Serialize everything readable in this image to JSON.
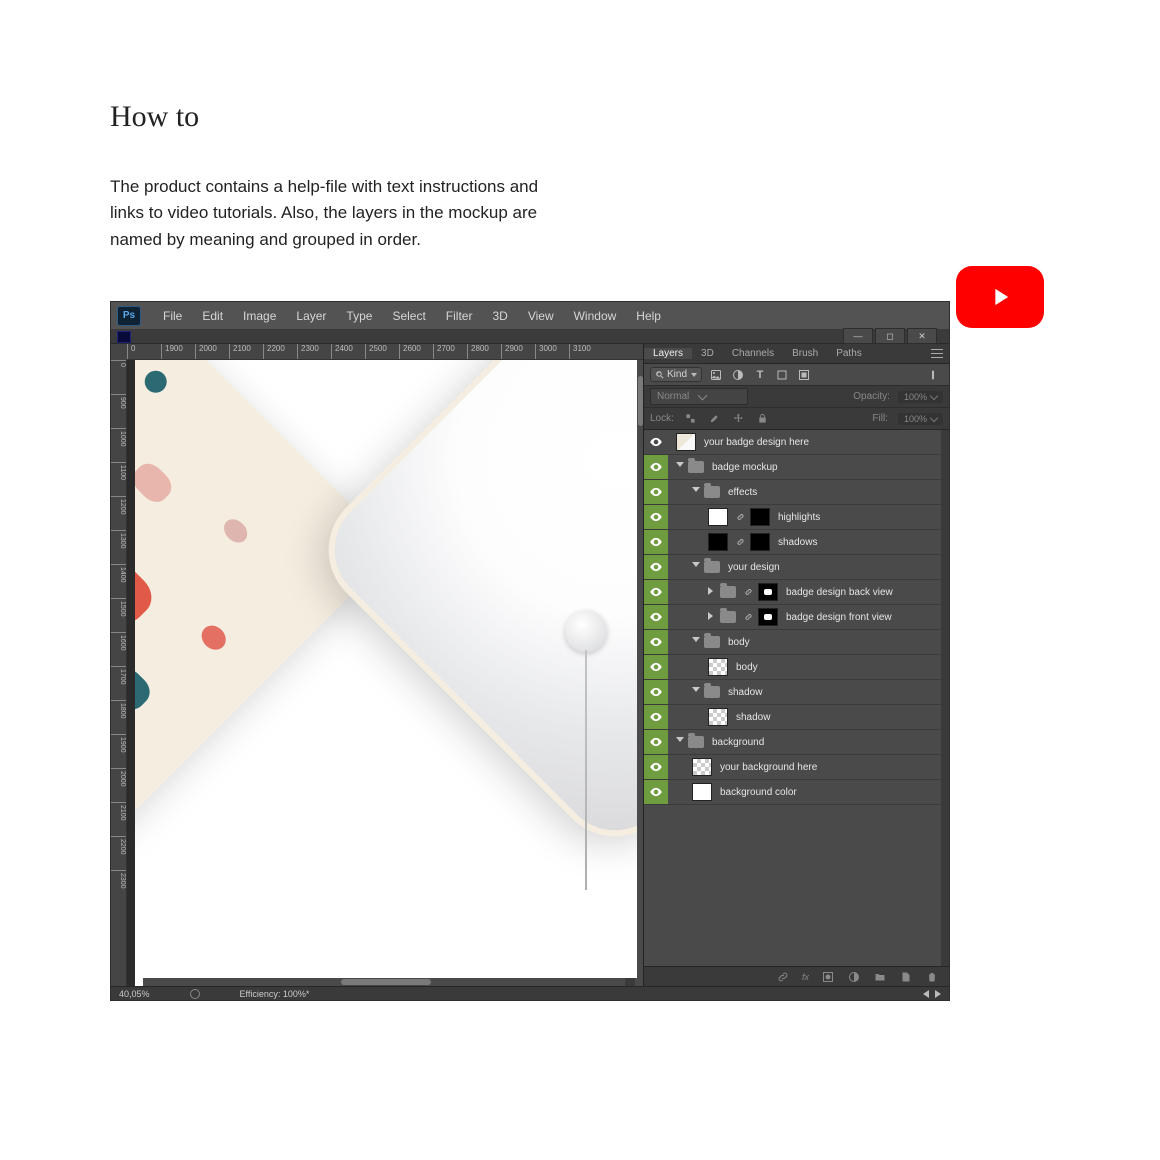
{
  "page": {
    "title": "How to",
    "intro": "The product contains a help-file with text instructions and links to video tutorials. Also, the layers in the mockup are named by meaning and grouped in order."
  },
  "ps": {
    "logo": "Ps",
    "menus": [
      "File",
      "Edit",
      "Image",
      "Layer",
      "Type",
      "Select",
      "Filter",
      "3D",
      "View",
      "Window",
      "Help"
    ],
    "ruler_h": [
      "0",
      "1900",
      "2000",
      "2100",
      "2200",
      "2300",
      "2400",
      "2500",
      "2600",
      "2700",
      "2800",
      "2900",
      "3000",
      "3100"
    ],
    "ruler_v": [
      "0",
      "900",
      "1000",
      "1100",
      "1200",
      "1300",
      "1400",
      "1500",
      "1600",
      "1700",
      "1800",
      "1900",
      "2000",
      "2100",
      "2200",
      "2300"
    ],
    "status_zoom": "40,05%",
    "status_eff": "Efficiency: 100%*"
  },
  "panel": {
    "tabs": [
      "Layers",
      "3D",
      "Channels",
      "Brush",
      "Paths"
    ],
    "kind_label": "Kind",
    "blend_mode": "Normal",
    "opacity_label": "Opacity:",
    "opacity_value": "100%",
    "lock_label": "Lock:",
    "fill_label": "Fill:",
    "fill_value": "100%",
    "layers": [
      {
        "eye": "off",
        "indent": 0,
        "type": "layer",
        "thumb": "canvas",
        "name": "your badge design here"
      },
      {
        "eye": "on",
        "indent": 0,
        "type": "folder",
        "open": true,
        "name": "badge mockup"
      },
      {
        "eye": "on",
        "indent": 1,
        "type": "folder",
        "open": true,
        "name": "effects"
      },
      {
        "eye": "on",
        "indent": 2,
        "type": "masklayer",
        "thumb": "white",
        "mask": "black",
        "name": "highlights"
      },
      {
        "eye": "on",
        "indent": 2,
        "type": "masklayer",
        "thumb": "black",
        "mask": "black",
        "name": "shadows"
      },
      {
        "eye": "on",
        "indent": 1,
        "type": "folder",
        "open": true,
        "name": "your design"
      },
      {
        "eye": "on",
        "indent": 2,
        "type": "smartmask",
        "closed": true,
        "thumb": "black",
        "mask": "white-dot",
        "name": "badge design back view"
      },
      {
        "eye": "on",
        "indent": 2,
        "type": "smartmask",
        "closed": true,
        "thumb": "black",
        "mask": "white-dot",
        "name": "badge design front view"
      },
      {
        "eye": "on",
        "indent": 1,
        "type": "folder",
        "open": true,
        "name": "body"
      },
      {
        "eye": "on",
        "indent": 2,
        "type": "layer",
        "thumb": "checker",
        "name": "body"
      },
      {
        "eye": "on",
        "indent": 1,
        "type": "folder",
        "open": true,
        "name": "shadow"
      },
      {
        "eye": "on",
        "indent": 2,
        "type": "layer",
        "thumb": "checker",
        "name": "shadow"
      },
      {
        "eye": "on",
        "indent": 0,
        "type": "folder",
        "open": true,
        "name": "background"
      },
      {
        "eye": "on",
        "indent": 1,
        "type": "layer",
        "thumb": "checker",
        "name": "your background here"
      },
      {
        "eye": "on",
        "indent": 1,
        "type": "layer",
        "thumb": "white",
        "name": "background color"
      }
    ]
  }
}
